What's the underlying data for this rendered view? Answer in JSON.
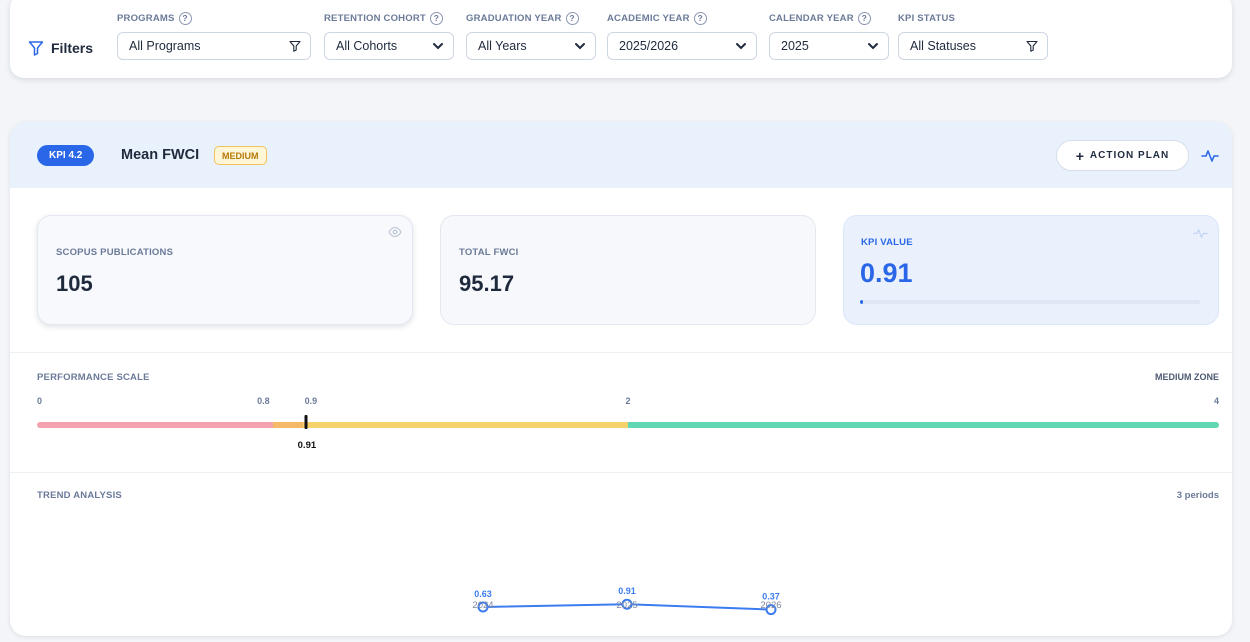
{
  "filters": {
    "title": "Filters",
    "groups": [
      {
        "label": "PROGRAMS",
        "help": "?",
        "value": "All Programs",
        "control": "filter"
      },
      {
        "label": "RETENTION COHORT",
        "help": "?",
        "value": "All Cohorts",
        "control": "dropdown"
      },
      {
        "label": "GRADUATION YEAR",
        "help": "?",
        "value": "All Years",
        "control": "dropdown"
      },
      {
        "label": "ACADEMIC YEAR",
        "help": "?",
        "value": "2025/2026",
        "control": "dropdown"
      },
      {
        "label": "CALENDAR YEAR",
        "help": "?",
        "value": "2025",
        "control": "dropdown"
      },
      {
        "label": "KPI STATUS",
        "help": "",
        "value": "All Statuses",
        "control": "filter"
      }
    ]
  },
  "kpi": {
    "badge": "KPI 4.2",
    "title": "Mean FWCI",
    "level": "MEDIUM",
    "action_plan_label": "ACTION PLAN",
    "action_plan_icon": "+",
    "metrics": {
      "publications_label": "SCOPUS PUBLICATIONS",
      "publications_value": "105",
      "total_fwci_label": "TOTAL FWCI",
      "total_fwci_value": "95.17",
      "kpi_value_label": "KPI VALUE",
      "kpi_value": "0.91",
      "kpi_progress_fraction": 0.01
    },
    "scale": {
      "label": "PERFORMANCE SCALE",
      "zone": "MEDIUM ZONE",
      "min": 0,
      "max": 4,
      "ticks": [
        {
          "value": 0,
          "label": "0"
        },
        {
          "value": 0.8,
          "label": "0.8"
        },
        {
          "value": 0.9,
          "label": "0.9"
        },
        {
          "value": 2,
          "label": "2"
        },
        {
          "value": 4,
          "label": "4"
        }
      ],
      "segments": [
        {
          "from": 0,
          "to": 0.8,
          "color": "#f4a3ae"
        },
        {
          "from": 0.8,
          "to": 0.9,
          "color": "#f5b96a"
        },
        {
          "from": 0.9,
          "to": 2,
          "color": "#f6d26a"
        },
        {
          "from": 2,
          "to": 4,
          "color": "#5fd7b3"
        }
      ],
      "marker_value": 0.91,
      "marker_label": "0.91"
    },
    "trend": {
      "label": "TREND ANALYSIS",
      "periods_text": "3 periods"
    }
  },
  "colors": {
    "accent": "#2a67e8",
    "trend_line": "#3b7cf0"
  },
  "chart_data": {
    "type": "line",
    "x": [
      "2024",
      "2025",
      "2026"
    ],
    "series": [
      {
        "values": [
          0.63,
          0.91,
          0.37
        ]
      }
    ],
    "point_labels": [
      "0.63",
      "0.91",
      "0.37"
    ]
  }
}
